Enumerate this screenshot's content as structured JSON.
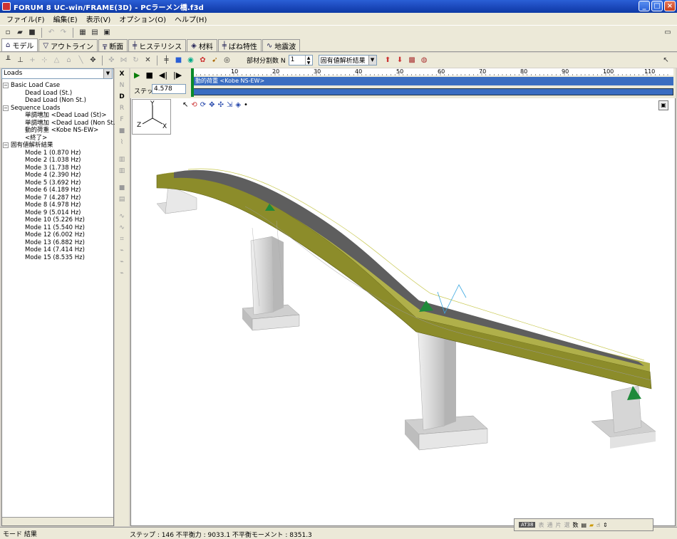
{
  "window": {
    "title": "FORUM 8  UC-win/FRAME(3D) - PCラーメン橋.f3d",
    "min_label": "_",
    "max_label": "□",
    "close_label": "×"
  },
  "menu": [
    "ファイル(F)",
    "編集(E)",
    "表示(V)",
    "オプション(O)",
    "ヘルプ(H)"
  ],
  "tabs": [
    {
      "label": "モデル",
      "icon": "model-icon"
    },
    {
      "label": "アウトライン",
      "icon": "outline-icon"
    },
    {
      "label": "断面",
      "icon": "section-icon"
    },
    {
      "label": "ヒステリシス",
      "icon": "hysteresis-icon"
    },
    {
      "label": "材料",
      "icon": "material-icon"
    },
    {
      "label": "ばね特性",
      "icon": "spring-icon"
    },
    {
      "label": "地震波",
      "icon": "wave-icon"
    }
  ],
  "model_toolbar": {
    "division_label": "部材分割数 N",
    "division_value": "1",
    "result_combo": "固有値解析結果"
  },
  "left": {
    "combo_value": "Loads",
    "tree": [
      {
        "level": 0,
        "label": "Basic Load Case",
        "exp": "−"
      },
      {
        "level": 1,
        "label": "Dead Load (St.)"
      },
      {
        "level": 1,
        "label": "Dead Load (Non St.)"
      },
      {
        "level": 0,
        "label": "Sequence Loads",
        "exp": "−"
      },
      {
        "level": 1,
        "label": "単調増加 <Dead Load (St)>"
      },
      {
        "level": 1,
        "label": "単調増加 <Dead Load (Non St.)>"
      },
      {
        "level": 1,
        "label": "動的荷重 <Kobe NS-EW>"
      },
      {
        "level": 1,
        "label": "<終了>"
      },
      {
        "level": 0,
        "label": "固有値解析結果",
        "exp": "−"
      },
      {
        "level": 1,
        "label": "Mode 1 (0.870 Hz)"
      },
      {
        "level": 1,
        "label": "Mode 2 (1.038 Hz)"
      },
      {
        "level": 1,
        "label": "Mode 3 (1.738 Hz)"
      },
      {
        "level": 1,
        "label": "Mode 4 (2.390 Hz)"
      },
      {
        "level": 1,
        "label": "Mode 5 (3.692 Hz)"
      },
      {
        "level": 1,
        "label": "Mode 6 (4.189 Hz)"
      },
      {
        "level": 1,
        "label": "Mode 7 (4.287 Hz)"
      },
      {
        "level": 1,
        "label": "Mode 8 (4.978 Hz)"
      },
      {
        "level": 1,
        "label": "Mode 9 (5.014 Hz)"
      },
      {
        "level": 1,
        "label": "Mode 10 (5.226 Hz)"
      },
      {
        "level": 1,
        "label": "Mode 11 (5.540 Hz)"
      },
      {
        "level": 1,
        "label": "Mode 12 (6.002 Hz)"
      },
      {
        "level": 1,
        "label": "Mode 13 (6.882 Hz)"
      },
      {
        "level": 1,
        "label": "Mode 14 (7.414 Hz)"
      },
      {
        "level": 1,
        "label": "Mode 15 (8.535 Hz)"
      }
    ]
  },
  "vtoolbar": [
    "X",
    "N",
    "D",
    "R",
    "F"
  ],
  "anim": {
    "step_label": "ステップ",
    "step_value": "4.578",
    "ruler_ticks": [
      "10",
      "20",
      "30",
      "40",
      "50",
      "60",
      "70",
      "80",
      "90",
      "100",
      "110"
    ],
    "ruler_max": 115,
    "track_label": "動的荷重 <Kobe NS-EW>"
  },
  "axes": {
    "y": "Y",
    "z": "Z",
    "x": "X"
  },
  "status": {
    "mode": "モード 結果",
    "info": "ステップ : 146  不平衡力 : 9033.1  不平衡モーメント : 8351.3",
    "panel_label": "AT38",
    "panel_items": [
      "表",
      "通",
      "片",
      "選",
      "数"
    ]
  },
  "colors": {
    "deck_top": "#5e5e5e",
    "girder": "#8c8c2a",
    "pier": "#d8d8d8",
    "support": "#1f8a3a",
    "track": "#3a6dc1"
  }
}
